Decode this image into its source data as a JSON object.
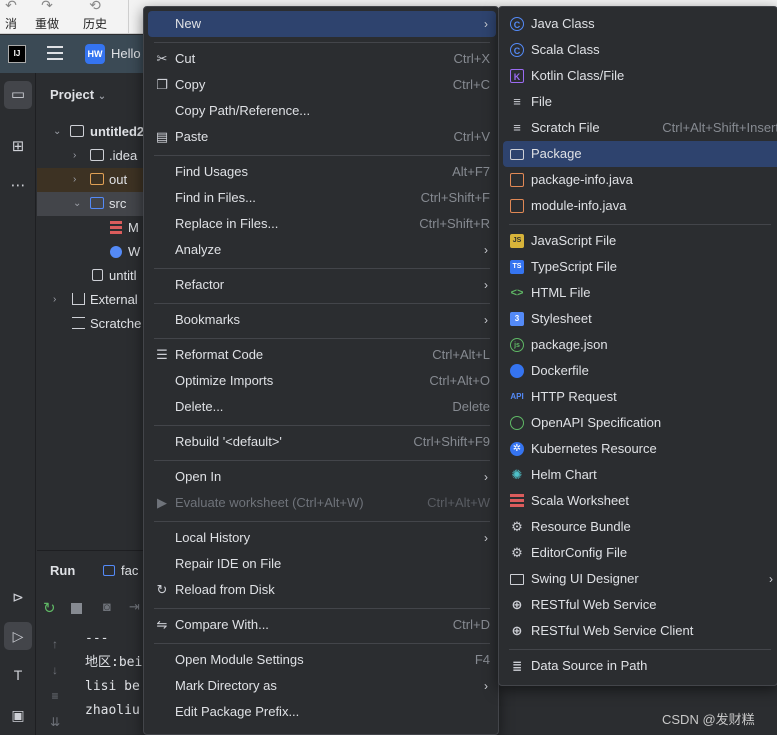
{
  "toolbar": {
    "undo_label": "消",
    "redo_label": "重做",
    "history_label": "历史"
  },
  "header": {
    "project_badge": "HW",
    "project_name": "Hello"
  },
  "project_panel": {
    "title": "Project",
    "tree": [
      {
        "label": "untitled2",
        "depth": 0
      },
      {
        "label": ".idea",
        "depth": 1
      },
      {
        "label": "out",
        "depth": 1
      },
      {
        "label": "src",
        "depth": 1
      },
      {
        "label": "M",
        "depth": 2
      },
      {
        "label": "W",
        "depth": 2
      },
      {
        "label": "untitl",
        "depth": 1
      },
      {
        "label": "External",
        "depth": 0
      },
      {
        "label": "Scratche",
        "depth": 0
      }
    ]
  },
  "run_panel": {
    "title": "Run",
    "tab": "fac",
    "console": [
      "---",
      "地区:bei",
      "lisi be",
      "zhaoliu"
    ]
  },
  "context_menu": {
    "items": [
      {
        "label": "New",
        "shortcut": "",
        "submenu": true,
        "icon": "",
        "highlighted": true
      },
      {
        "label": "Cut",
        "shortcut": "Ctrl+X",
        "icon": "scissors-icon"
      },
      {
        "label": "Copy",
        "shortcut": "Ctrl+C",
        "icon": "copy-icon"
      },
      {
        "label": "Copy Path/Reference...",
        "shortcut": ""
      },
      {
        "label": "Paste",
        "shortcut": "Ctrl+V",
        "icon": "paste-icon"
      },
      {
        "label": "Find Usages",
        "shortcut": "Alt+F7"
      },
      {
        "label": "Find in Files...",
        "shortcut": "Ctrl+Shift+F"
      },
      {
        "label": "Replace in Files...",
        "shortcut": "Ctrl+Shift+R"
      },
      {
        "label": "Analyze",
        "shortcut": "",
        "submenu": true
      },
      {
        "label": "Refactor",
        "shortcut": "",
        "submenu": true
      },
      {
        "label": "Bookmarks",
        "shortcut": "",
        "submenu": true
      },
      {
        "label": "Reformat Code",
        "shortcut": "Ctrl+Alt+L",
        "icon": "reformat-icon"
      },
      {
        "label": "Optimize Imports",
        "shortcut": "Ctrl+Alt+O"
      },
      {
        "label": "Delete...",
        "shortcut": "Delete"
      },
      {
        "label": "Rebuild '<default>'",
        "shortcut": "Ctrl+Shift+F9"
      },
      {
        "label": "Open In",
        "shortcut": "",
        "submenu": true
      },
      {
        "label": "Evaluate worksheet (Ctrl+Alt+W)",
        "shortcut": "Ctrl+Alt+W",
        "icon": "play-icon",
        "disabled": true
      },
      {
        "label": "Local History",
        "shortcut": "",
        "submenu": true
      },
      {
        "label": "Repair IDE on File",
        "shortcut": ""
      },
      {
        "label": "Reload from Disk",
        "shortcut": "",
        "icon": "reload-icon"
      },
      {
        "label": "Compare With...",
        "shortcut": "Ctrl+D",
        "icon": "compare-icon"
      },
      {
        "label": "Open Module Settings",
        "shortcut": "F4"
      },
      {
        "label": "Mark Directory as",
        "shortcut": "",
        "submenu": true
      },
      {
        "label": "Edit Package Prefix...",
        "shortcut": ""
      }
    ]
  },
  "new_submenu": {
    "items": [
      {
        "label": "Java Class",
        "icon": "java-class-icon",
        "color": "#548af7"
      },
      {
        "label": "Scala Class",
        "icon": "scala-class-icon",
        "color": "#548af7"
      },
      {
        "label": "Kotlin Class/File",
        "icon": "kotlin-icon",
        "color": "#9b6bf2"
      },
      {
        "label": "File",
        "icon": "file-icon",
        "color": "#ced0d6"
      },
      {
        "label": "Scratch File",
        "shortcut": "Ctrl+Alt+Shift+Insert",
        "icon": "scratch-file-icon",
        "color": "#ced0d6"
      },
      {
        "label": "Package",
        "icon": "package-icon",
        "color": "#ced0d6",
        "highlighted": true
      },
      {
        "label": "package-info.java",
        "icon": "java-file-icon",
        "color": "#e08855"
      },
      {
        "label": "module-info.java",
        "icon": "java-file-icon",
        "color": "#e08855"
      },
      {
        "label": "JavaScript File",
        "icon": "javascript-icon",
        "color": "#d7b33a"
      },
      {
        "label": "TypeScript File",
        "icon": "typescript-icon",
        "color": "#3574f0"
      },
      {
        "label": "HTML File",
        "icon": "html-icon",
        "color": "#5fb865"
      },
      {
        "label": "Stylesheet",
        "icon": "css-icon",
        "color": "#548af7"
      },
      {
        "label": "package.json",
        "icon": "nodejs-icon",
        "color": "#5fb865"
      },
      {
        "label": "Dockerfile",
        "icon": "docker-icon",
        "color": "#3574f0"
      },
      {
        "label": "HTTP Request",
        "icon": "api-icon",
        "color": "#548af7"
      },
      {
        "label": "OpenAPI Specification",
        "icon": "openapi-icon",
        "color": "#5fb865"
      },
      {
        "label": "Kubernetes Resource",
        "icon": "kubernetes-icon",
        "color": "#3574f0"
      },
      {
        "label": "Helm Chart",
        "icon": "helm-icon",
        "color": "#4fc1c9"
      },
      {
        "label": "Scala Worksheet",
        "icon": "scala-worksheet-icon",
        "color": "#db5c5c"
      },
      {
        "label": "Resource Bundle",
        "icon": "gear-icon",
        "color": "#ced0d6"
      },
      {
        "label": "EditorConfig File",
        "icon": "gear-icon",
        "color": "#ced0d6"
      },
      {
        "label": "Swing UI Designer",
        "icon": "window-icon",
        "color": "#ced0d6",
        "submenu": true
      },
      {
        "label": "RESTful Web Service",
        "icon": "globe-icon",
        "color": "#ced0d6"
      },
      {
        "label": "RESTful Web Service Client",
        "icon": "globe-icon",
        "color": "#ced0d6"
      },
      {
        "label": "Data Source in Path",
        "icon": "database-icon",
        "color": "#ced0d6"
      }
    ]
  },
  "watermark": "CSDN @发财糕"
}
